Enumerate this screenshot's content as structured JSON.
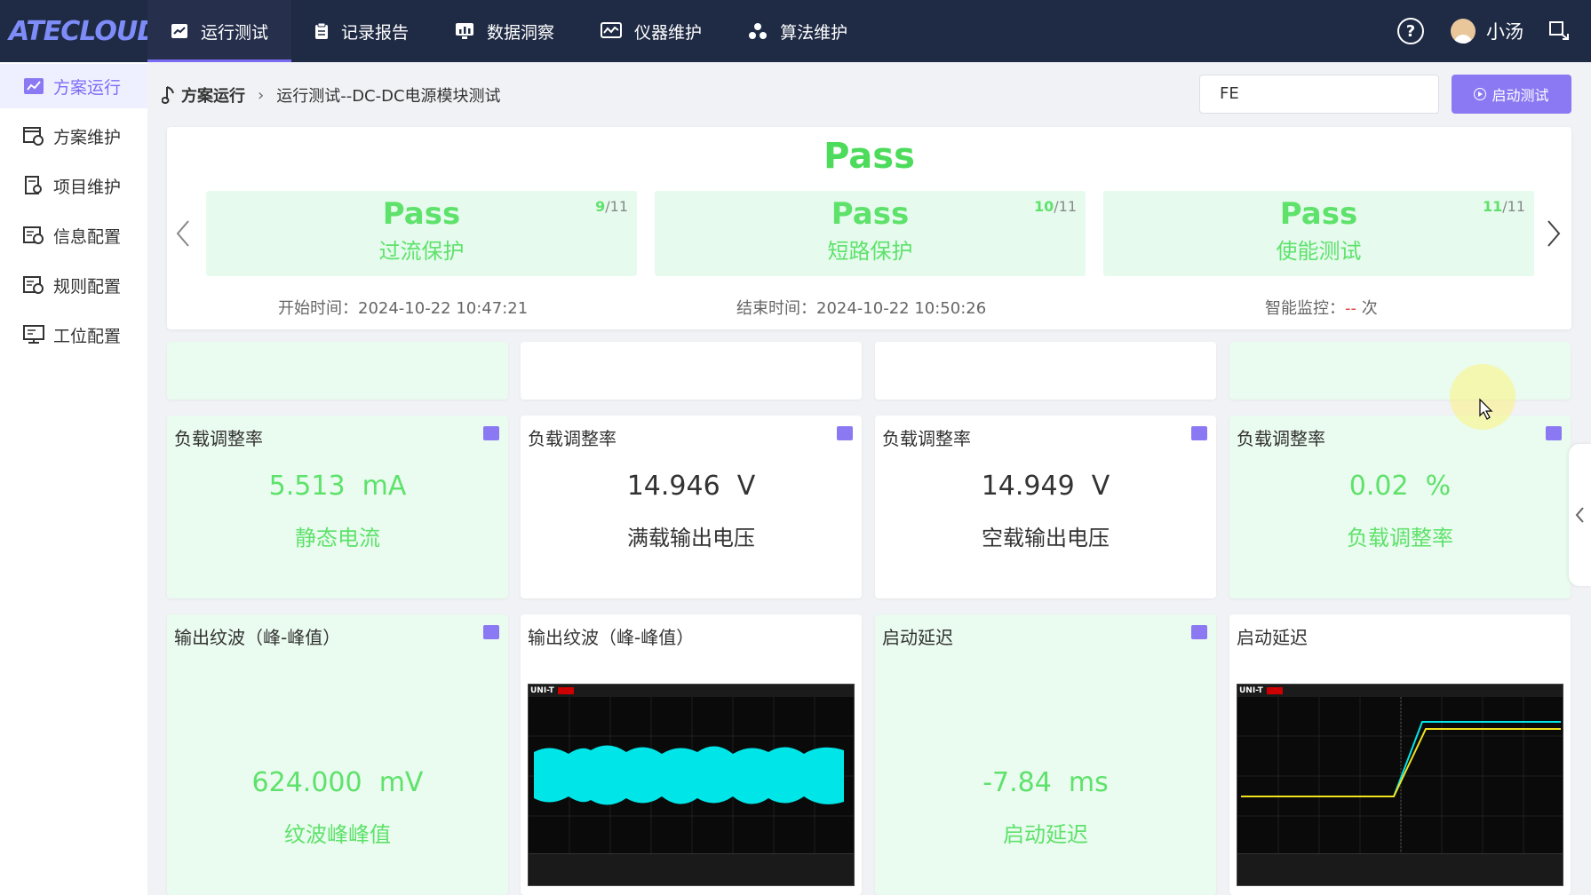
{
  "app": {
    "logo": "ATECLOUD"
  },
  "nav": {
    "items": [
      {
        "label": "运行测试",
        "icon": "chart-line-icon",
        "active": true
      },
      {
        "label": "记录报告",
        "icon": "clipboard-icon",
        "active": false
      },
      {
        "label": "数据洞察",
        "icon": "monitor-chart-icon",
        "active": false
      },
      {
        "label": "仪器维护",
        "icon": "instrument-icon",
        "active": false
      },
      {
        "label": "算法维护",
        "icon": "algorithm-icon",
        "active": false
      }
    ],
    "help": "?",
    "username": "小汤"
  },
  "sidebar": {
    "items": [
      {
        "label": "方案运行",
        "icon": "chart-line-icon",
        "active": true
      },
      {
        "label": "方案维护",
        "icon": "window-gear-icon",
        "active": false
      },
      {
        "label": "项目维护",
        "icon": "document-search-icon",
        "active": false
      },
      {
        "label": "信息配置",
        "icon": "info-config-icon",
        "active": false
      },
      {
        "label": "规则配置",
        "icon": "rule-config-icon",
        "active": false
      },
      {
        "label": "工位配置",
        "icon": "workstation-icon",
        "active": false
      }
    ]
  },
  "breadcrumb": {
    "root": "方案运行",
    "current": "运行测试--DC-DC电源模块测试"
  },
  "search": {
    "value": "FE"
  },
  "start_button": {
    "label": "启动测试"
  },
  "summary": {
    "status": "Pass",
    "steps": [
      {
        "status": "Pass",
        "name": "过流保护",
        "index": "9",
        "total": "/11"
      },
      {
        "status": "Pass",
        "name": "短路保护",
        "index": "10",
        "total": "/11"
      },
      {
        "status": "Pass",
        "name": "使能测试",
        "index": "11",
        "total": "/11"
      }
    ],
    "start_label": "开始时间：",
    "start_time": "2024-10-22 10:47:21",
    "end_label": "结束时间：",
    "end_time": "2024-10-22 10:50:26",
    "monitor_label": "智能监控：",
    "monitor_value": "--",
    "monitor_unit": " 次"
  },
  "cards_row1": [
    {
      "title": "负载调整率",
      "value": "5.513",
      "unit": "mA",
      "label": "静态电流",
      "pass": true
    },
    {
      "title": "负载调整率",
      "value": "14.946",
      "unit": "V",
      "label": "满载输出电压",
      "pass": false
    },
    {
      "title": "负载调整率",
      "value": "14.949",
      "unit": "V",
      "label": "空载输出电压",
      "pass": false
    },
    {
      "title": "负载调整率",
      "value": "0.02",
      "unit": "%",
      "label": "负载调整率",
      "pass": true
    }
  ],
  "cards_row2": [
    {
      "title": "输出纹波（峰-峰值）",
      "value": "624.000",
      "unit": "mV",
      "label": "纹波峰峰值"
    },
    {
      "title": "输出纹波（峰-峰值）",
      "scope_brand": "UNI-T"
    },
    {
      "title": "启动延迟",
      "value": "-7.84",
      "unit": "ms",
      "label": "启动延迟"
    },
    {
      "title": "启动延迟",
      "scope_brand": "UNI-T"
    }
  ],
  "colors": {
    "accent": "#8b79f3",
    "pass": "#5ee26b",
    "nav_bg": "#1f2a44"
  }
}
